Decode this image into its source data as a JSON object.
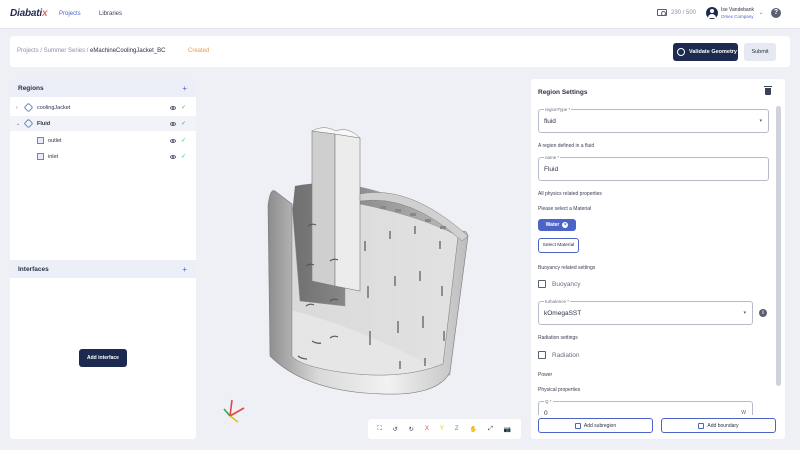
{
  "topbar": {
    "logo_main": "Diabati",
    "logo_accent": "x",
    "nav_projects": "Projects",
    "nav_libraries": "Libraries",
    "credits": "230 / 500",
    "user_name": "Ise Vandebank",
    "user_company": "Omex Company",
    "help": "?"
  },
  "breadcrumb": {
    "path": "Projects / Summer Series / ",
    "current": "eMachineCoolingJacket_BC",
    "status": "Created",
    "validate_label": "Validate Geometry",
    "submit_label": "Submit"
  },
  "regions": {
    "title": "Regions",
    "add": "+",
    "items": [
      {
        "label": "coolingJacket",
        "check": "✓"
      },
      {
        "label": "Fluid",
        "check": "✓"
      },
      {
        "label": "outlet",
        "check": "✓"
      },
      {
        "label": "inlet",
        "check": "✓"
      }
    ]
  },
  "interfaces": {
    "title": "Interfaces",
    "add": "+",
    "add_button": "Add interface"
  },
  "viewport": {
    "toolbar": [
      "⛶",
      "↺",
      "↻",
      "X",
      "Y",
      "Z",
      "✋",
      "⤢",
      "📷"
    ]
  },
  "settings": {
    "title": "Region Settings",
    "region_type_label": "regionType *",
    "region_type_value": "fluid",
    "defined_note": "A region defined in a fluid",
    "name_label": "name *",
    "name_value": "Fluid",
    "physics_note": "All physics related properties",
    "material_prompt": "Please select a Material",
    "material_chip": "Water",
    "material_chip_x": "×",
    "select_material": "Select Material",
    "buoyancy_settings": "Buoyancy related settings",
    "buoyancy_label": "Buoyancy",
    "turbulence_label": "turbulence *",
    "turbulence_value": "kOmegaSST",
    "info": "i",
    "radiation_settings": "Radiation settings",
    "radiation_label": "Radiation",
    "power": "Power",
    "physical_properties": "Physical properties",
    "q_label": "Q *",
    "q_value": "0",
    "q_unit": "W",
    "add_subregion": "Add subregion",
    "add_boundary": "Add boundary"
  },
  "colors": {
    "primary": "#1b2a4e",
    "accent": "#4c64c7",
    "status": "#e59b56",
    "ok": "#3cb371"
  }
}
